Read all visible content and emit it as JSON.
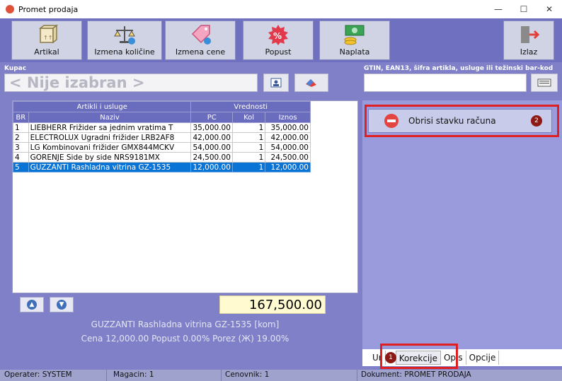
{
  "window": {
    "title": "Promet prodaja"
  },
  "toolbar": {
    "artikal": "Artikal",
    "izmena_kolicine": "Izmena količine",
    "izmena_cene": "Izmena cene",
    "popust": "Popust",
    "naplata": "Naplata",
    "izlaz": "Izlaz"
  },
  "kupac": {
    "label": "Kupac",
    "value": "< Nije izabran >"
  },
  "gtin": {
    "label": "GTIN, EAN13, šifra artikla, usluge ili težinski bar-kod",
    "value": ""
  },
  "table": {
    "group_headers": [
      "Artikli i usluge",
      "Vrednosti"
    ],
    "columns": [
      "BR",
      "Naziv",
      "PC",
      "Kol",
      "Iznos"
    ],
    "rows": [
      {
        "br": "1",
        "naziv": "LIEBHERR Frižider sa jednim vratima T",
        "pc": "35,000.00",
        "kol": "1",
        "iznos": "35,000.00"
      },
      {
        "br": "2",
        "naziv": "ELECTROLUX Ugradni frižider LRB2AF8",
        "pc": "42,000.00",
        "kol": "1",
        "iznos": "42,000.00"
      },
      {
        "br": "3",
        "naziv": "LG Kombinovani frižider GMX844MCKV",
        "pc": "54,000.00",
        "kol": "1",
        "iznos": "54,000.00"
      },
      {
        "br": "4",
        "naziv": "GORENJE Side by side NRS9181MX",
        "pc": "24,500.00",
        "kol": "1",
        "iznos": "24,500.00"
      },
      {
        "br": "5",
        "naziv": "GUZZANTI Rashladna vitrina GZ-1535",
        "pc": "12,000.00",
        "kol": "1",
        "iznos": "12,000.00"
      }
    ],
    "selected_row": 5
  },
  "total": "167,500.00",
  "selected_item": {
    "name": "GUZZANTI Rashladna vitrina GZ-1535 [kom]",
    "details": "Cena 12,000.00  Popust 0.00%   Porez  (Ж) 19.00%"
  },
  "right_panel": {
    "obrisi_label": "Obrisi stavku računa",
    "badge_2": "2",
    "badge_1": "1"
  },
  "tabs": {
    "items": [
      "Ur",
      "Korekcije",
      "Opis",
      "Opcije"
    ],
    "active": "Korekcije"
  },
  "status": {
    "operater": "Operater: SYSTEM",
    "magacin": "Magacin: 1",
    "cenovnik": "Cenovnik: 1",
    "dokument": "Dokument: PROMET PRODAJA"
  }
}
